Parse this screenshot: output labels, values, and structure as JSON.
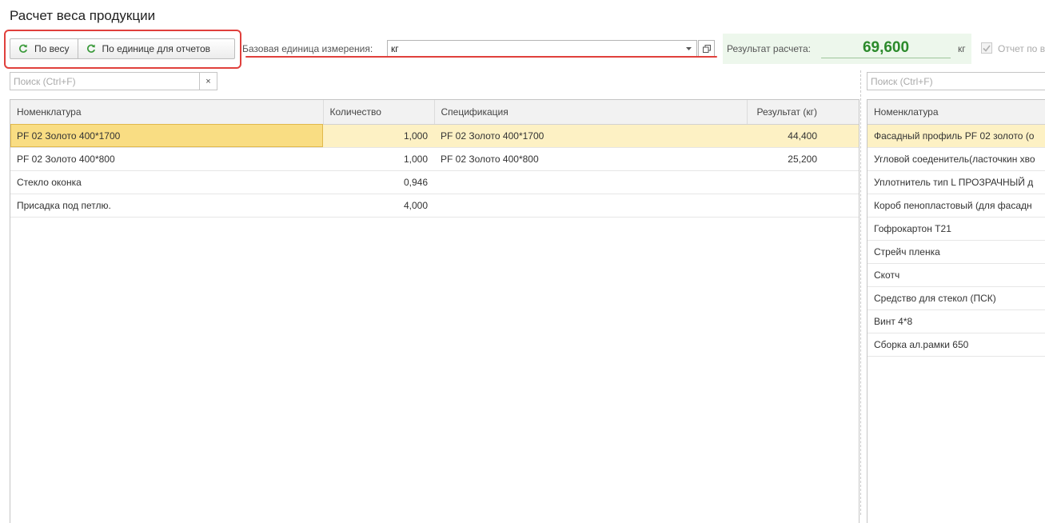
{
  "page": {
    "title": "Расчет веса продукции"
  },
  "toolbar": {
    "by_weight_label": "По весу",
    "by_report_unit_label": "По единице для отчетов",
    "refresh_icon": "refresh-icon"
  },
  "unit": {
    "label": "Базовая единица измерения:",
    "value": "кг"
  },
  "result": {
    "label": "Результат расчета:",
    "value": "69,600",
    "unit": "кг"
  },
  "report": {
    "label": "Отчет по в",
    "checked": true
  },
  "search": {
    "placeholder": "Поиск (Ctrl+F)",
    "clear_glyph": "×"
  },
  "colors": {
    "result_value": "#2b8a2b",
    "highlight": "#e0403c",
    "selected_row": "#fdf1c4",
    "current_cell": "#f9dd83"
  },
  "table": {
    "columns": [
      "Номенклатура",
      "Количество",
      "Спецификация",
      "Результат (кг)"
    ],
    "rows": [
      {
        "name": "PF 02 Золото 400*1700",
        "qty": "1,000",
        "spec": "PF 02 Золото 400*1700",
        "result": "44,400"
      },
      {
        "name": "PF 02 Золото 400*800",
        "qty": "1,000",
        "spec": "PF 02 Золото 400*800",
        "result": "25,200"
      },
      {
        "name": "Стекло оконка",
        "qty": "0,946",
        "spec": "",
        "result": ""
      },
      {
        "name": "Присадка под петлю.",
        "qty": "4,000",
        "spec": "",
        "result": ""
      }
    ]
  },
  "right_table": {
    "columns": [
      "Номенклатура"
    ],
    "rows": [
      "Фасадный профиль PF 02 золото (о",
      "Угловой соеденитель(ласточкин хво",
      "Уплотнитель тип L ПРОЗРАЧНЫЙ д",
      "Короб пенопластовый (для фасадн",
      "Гофрокартон Т21",
      "Стрейч пленка",
      "Скотч",
      "Средство для стекол (ПСК)",
      "Винт 4*8",
      "Сборка ал.рамки 650"
    ]
  }
}
